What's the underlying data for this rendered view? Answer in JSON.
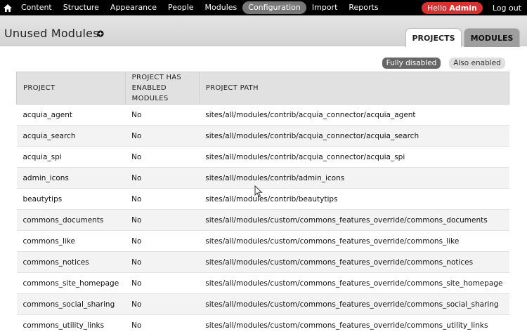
{
  "toolbar": {
    "home_icon": "home-icon",
    "items": [
      "Content",
      "Structure",
      "Appearance",
      "People",
      "Modules",
      "Configuration",
      "Import",
      "Reports"
    ],
    "active_index": 5,
    "hello_prefix": "Hello",
    "hello_user": "Admin",
    "logout": "Log out"
  },
  "header": {
    "title": "Unused Modules",
    "add_icon": "plus-circle-icon",
    "tabs": [
      "PROJECTS",
      "MODULES"
    ],
    "active_tab": "PROJECTS"
  },
  "filters": {
    "fully_disabled": "Fully disabled",
    "also_enabled": "Also enabled",
    "active": "Fully disabled"
  },
  "table": {
    "headers": [
      "PROJECT",
      "PROJECT HAS ENABLED MODULES",
      "PROJECT PATH"
    ],
    "rows": [
      [
        "acquia_agent",
        "No",
        "sites/all/modules/contrib/acquia_connector/acquia_agent"
      ],
      [
        "acquia_search",
        "No",
        "sites/all/modules/contrib/acquia_connector/acquia_search"
      ],
      [
        "acquia_spi",
        "No",
        "sites/all/modules/contrib/acquia_connector/acquia_spi"
      ],
      [
        "admin_icons",
        "No",
        "sites/all/modules/contrib/admin_icons"
      ],
      [
        "beautytips",
        "No",
        "sites/all/modules/contrib/beautytips"
      ],
      [
        "commons_documents",
        "No",
        "sites/all/modules/custom/commons_features_override/commons_documents"
      ],
      [
        "commons_like",
        "No",
        "sites/all/modules/custom/commons_features_override/commons_like"
      ],
      [
        "commons_notices",
        "No",
        "sites/all/modules/custom/commons_features_override/commons_notices"
      ],
      [
        "commons_site_homepage",
        "No",
        "sites/all/modules/custom/commons_features_override/commons_site_homepage"
      ],
      [
        "commons_social_sharing",
        "No",
        "sites/all/modules/custom/commons_features_override/commons_social_sharing"
      ],
      [
        "commons_utility_links",
        "No",
        "sites/all/modules/custom/commons_features_override/commons_utility_links"
      ]
    ]
  }
}
